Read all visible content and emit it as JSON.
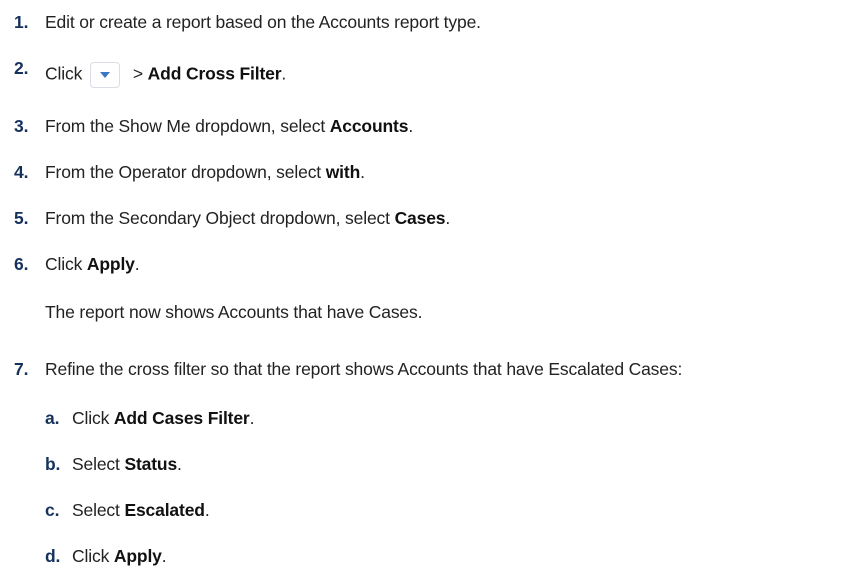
{
  "steps": [
    {
      "number": "1.",
      "text": "Edit or create a report based on the Accounts report type."
    },
    {
      "number": "2.",
      "pre": "Click",
      "icon": "dropdown-arrow-icon",
      "post": " > ",
      "bold": "Add Cross Filter",
      "end": "."
    },
    {
      "number": "3.",
      "pre": "From the Show Me dropdown, select ",
      "bold": "Accounts",
      "end": "."
    },
    {
      "number": "4.",
      "pre": "From the Operator dropdown, select ",
      "bold": "with",
      "end": "."
    },
    {
      "number": "5.",
      "pre": "From the Secondary Object dropdown, select ",
      "bold": "Cases",
      "end": "."
    },
    {
      "number": "6.",
      "pre": "Click ",
      "bold": "Apply",
      "end": ".",
      "note": "The report now shows Accounts that have Cases."
    },
    {
      "number": "7.",
      "text": "Refine the cross filter so that the report shows Accounts that have Escalated Cases:"
    }
  ],
  "substeps": [
    {
      "letter": "a.",
      "pre": "Click ",
      "bold": "Add Cases Filter",
      "end": "."
    },
    {
      "letter": "b.",
      "pre": "Select ",
      "bold": "Status",
      "end": "."
    },
    {
      "letter": "c.",
      "pre": "Select ",
      "bold": "Escalated",
      "end": "."
    },
    {
      "letter": "d.",
      "pre": "Click ",
      "bold": "Apply",
      "end": "."
    }
  ],
  "colors": {
    "number": "#16325c",
    "text": "#222222",
    "icon_border": "#d8dde6",
    "icon_arrow": "#3a76c4"
  }
}
